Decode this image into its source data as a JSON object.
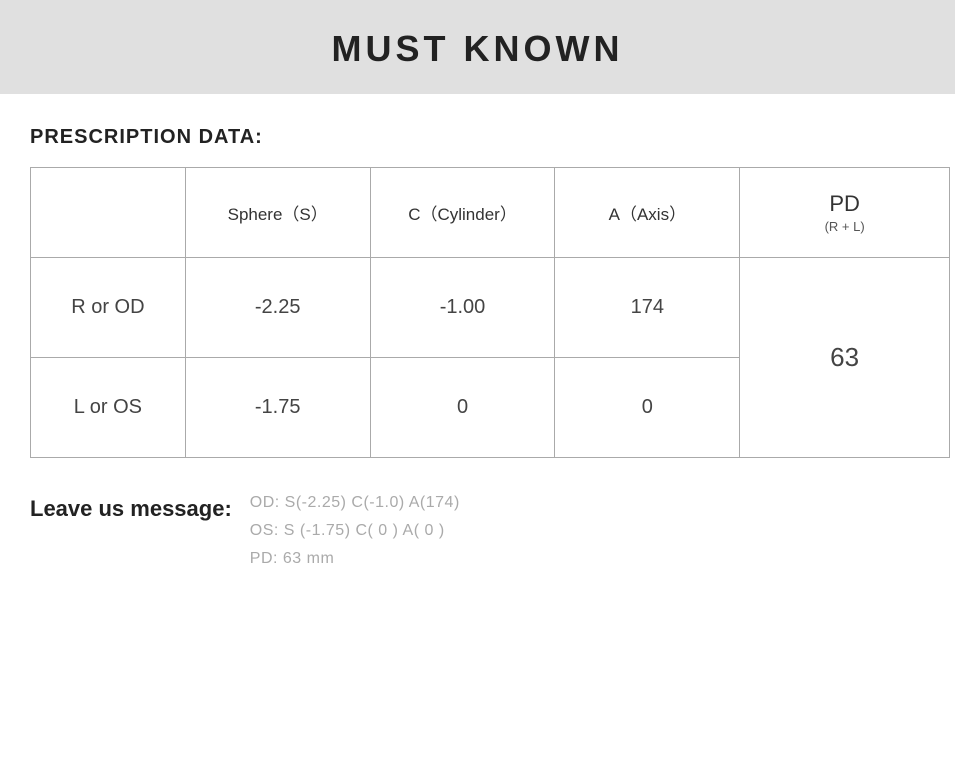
{
  "header": {
    "title": "MUST KNOWN"
  },
  "section": {
    "prescription_title": "PRESCRIPTION DATA:"
  },
  "table": {
    "headers": {
      "empty": "",
      "sphere": "Sphere（S）",
      "cylinder": "C（Cylinder）",
      "axis": "A（Axis）",
      "pd_main": "PD",
      "pd_sub": "(R + L)"
    },
    "rows": [
      {
        "label": "R or OD",
        "sphere": "-2.25",
        "cylinder": "-1.00",
        "axis": "174"
      },
      {
        "label": "L or OS",
        "sphere": "-1.75",
        "cylinder": "0",
        "axis": "0"
      }
    ],
    "pd_value": "63"
  },
  "leave_message": {
    "label": "Leave us message:",
    "lines": [
      "OD:  S(-2.25)    C(-1.0)    A(174)",
      "OS:  S (-1.75)    C( 0 )     A( 0 )",
      "PD:  63 mm"
    ]
  }
}
